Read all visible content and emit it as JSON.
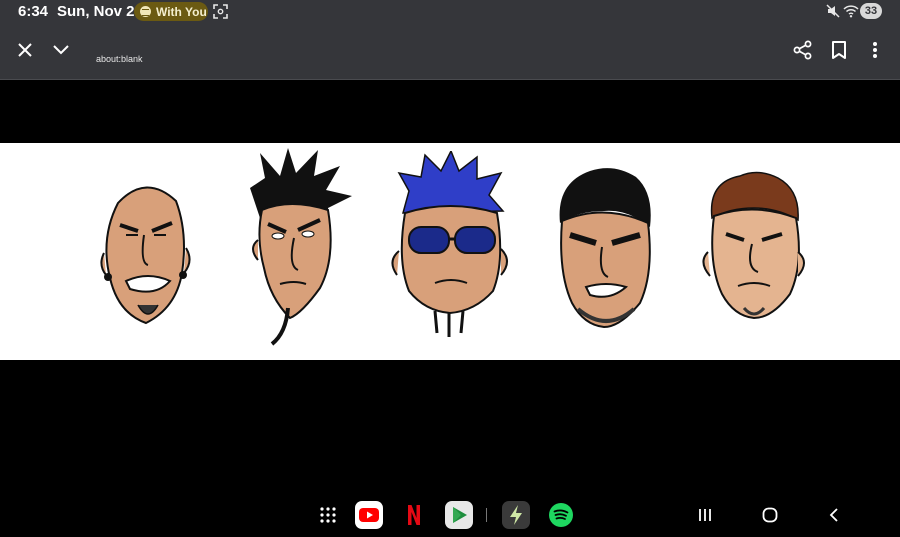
{
  "status_bar": {
    "time": "6:34",
    "date": "Sun, Nov 2",
    "media_pill_label": "With You",
    "battery_level": "33"
  },
  "toolbar": {
    "url": "about:blank"
  },
  "content": {
    "background": "#ffffff",
    "faces": [
      "bald-face",
      "spiky-hair-face",
      "blue-goggles-face",
      "black-hair-face",
      "brown-hair-face"
    ]
  },
  "navbar": {
    "apps": [
      "app-drawer-icon",
      "youtube-icon",
      "netflix-icon",
      "google-play-games-icon",
      "app-icon",
      "spotify-icon"
    ],
    "keys": [
      "recent-apps-icon",
      "home-icon",
      "back-icon"
    ]
  },
  "colors": {
    "chrome": "#35363a",
    "media_pill": "#6b5a12",
    "youtube": "#ff0000",
    "netflix": "#e50914",
    "spotify": "#1ed760"
  }
}
